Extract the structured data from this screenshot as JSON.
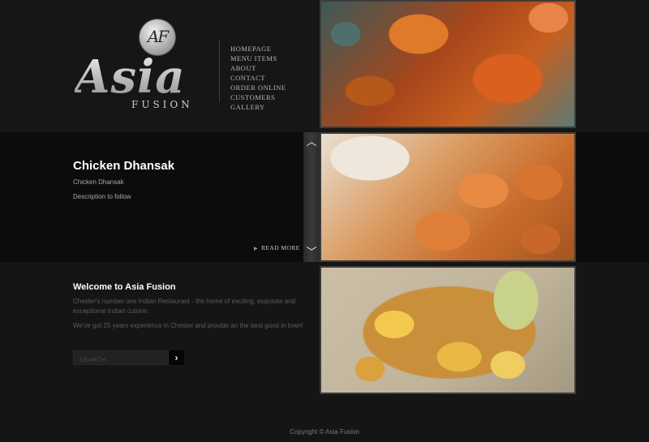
{
  "brand": {
    "monogram": "AF",
    "name": "Asia",
    "subtitle": "FUSION"
  },
  "nav": {
    "items": [
      "HOMEPAGE",
      "MENU ITEMS",
      "ABOUT",
      "CONTACT",
      "ORDER ONLINE",
      "CUSTOMERS",
      "GALLERY"
    ]
  },
  "slider": {
    "title": "Chicken Dhansak",
    "subtitle": "Chicken Dhansak",
    "description": "Description to follow",
    "read_more": "READ MORE",
    "icons": {
      "up": "chevron-up-icon",
      "down": "chevron-down-icon",
      "read_more": "triangle-right-icon"
    }
  },
  "welcome": {
    "title": "Welcome to Asia Fusion",
    "paragraph1": "Chester's number one Indian Restaurant - the home of exciting, exquisite and exceptional Indian cuisine.",
    "paragraph2": "We've got 25 years experience in Chester and provide an the best good in town!"
  },
  "search": {
    "placeholder": "SEARCH",
    "value": "",
    "button_icon": "chevron-right-icon"
  },
  "footer": {
    "copyright": "Copyright © Asia Fusion"
  },
  "colors": {
    "background": "#151515",
    "slider_band": "#0c0c0c",
    "heading": "#ffffff",
    "body_text": "#5c5c5c"
  }
}
